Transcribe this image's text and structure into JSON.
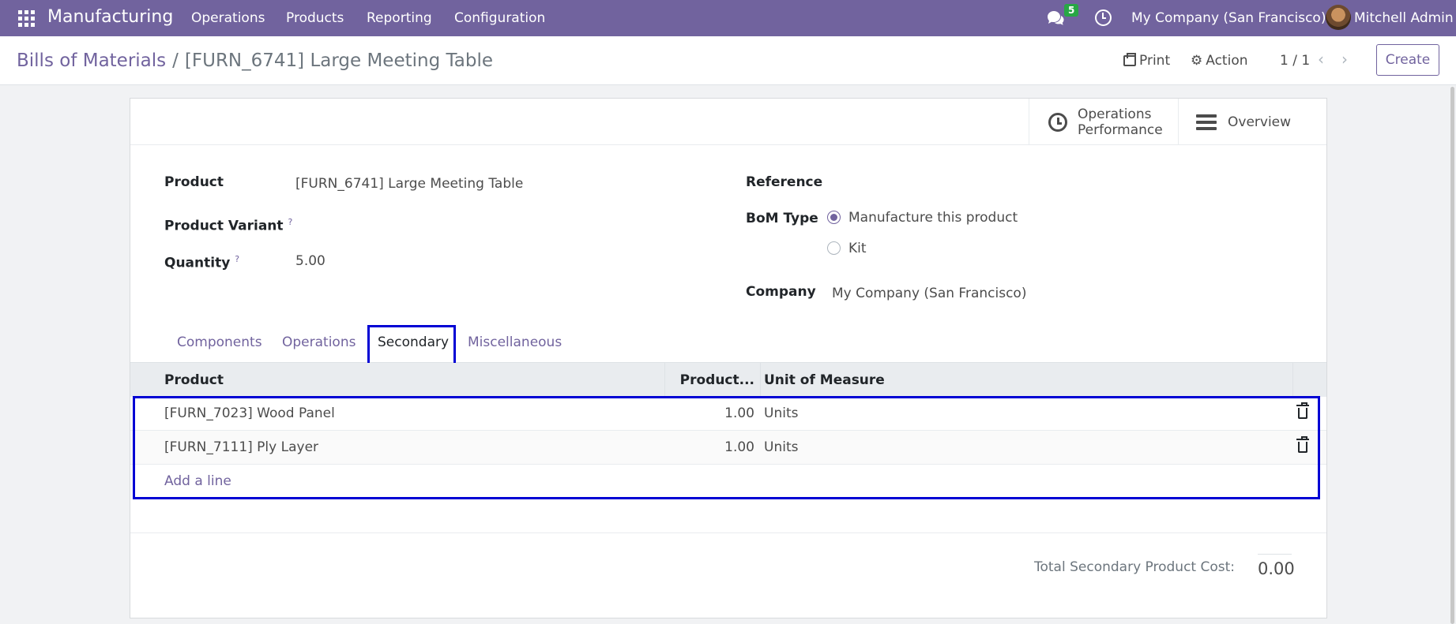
{
  "navbar": {
    "app_name": "Manufacturing",
    "menu": [
      "Operations",
      "Products",
      "Reporting",
      "Configuration"
    ],
    "chat_badge": "5",
    "company": "My Company (San Francisco)",
    "user": "Mitchell Admin"
  },
  "control": {
    "breadcrumb_parent": "Bills of Materials",
    "breadcrumb_separator": "/",
    "breadcrumb_current": "[FURN_6741] Large Meeting Table",
    "print_label": "Print",
    "action_label": "Action",
    "pager": "1 / 1",
    "create_label": "Create"
  },
  "smart_buttons": {
    "performance_label": "Operations Performance",
    "overview_label": "Overview"
  },
  "form": {
    "product_label": "Product",
    "product_value": "[FURN_6741] Large Meeting Table",
    "variant_label": "Product Variant",
    "quantity_label": "Quantity",
    "quantity_value": "5.00",
    "help_mark": "?",
    "reference_label": "Reference",
    "bom_type_label": "BoM Type",
    "bom_type_options": [
      "Manufacture this product",
      "Kit"
    ],
    "bom_type_selected": "Manufacture this product",
    "company_label": "Company",
    "company_value": "My Company (San Francisco)"
  },
  "tabs": [
    "Components",
    "Operations",
    "Secondary",
    "Miscellaneous"
  ],
  "active_tab": "Secondary",
  "table": {
    "headers": [
      "Product",
      "Product...",
      "Unit of Measure"
    ],
    "rows": [
      {
        "product": "[FURN_7023] Wood Panel",
        "quantity": "1.00",
        "uom": "Units"
      },
      {
        "product": "[FURN_7111] Ply Layer",
        "quantity": "1.00",
        "uom": "Units"
      }
    ],
    "add_line_label": "Add a line"
  },
  "totals": {
    "label": "Total Secondary Product Cost:",
    "value": "0.00"
  },
  "colors": {
    "brand": "#71639e",
    "highlight": "#0000d4",
    "badge": "#28a745"
  }
}
